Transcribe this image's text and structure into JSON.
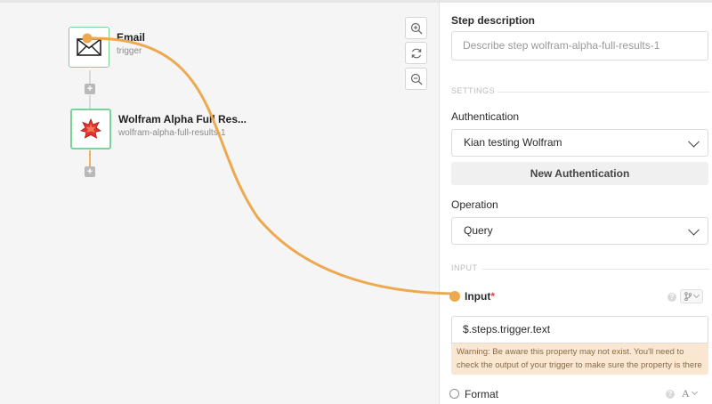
{
  "canvas": {
    "nodes": [
      {
        "title": "Email",
        "subtitle": "trigger",
        "icon": "envelope-icon"
      },
      {
        "title": "Wolfram Alpha Full Res...",
        "subtitle": "wolfram-alpha-full-results-1",
        "icon": "wolfram-logo-icon"
      }
    ],
    "add_step_symbol": "+",
    "controls": [
      "zoom-in-icon",
      "refresh-icon",
      "zoom-out-icon"
    ],
    "wire_color": "#eda94f"
  },
  "panel": {
    "step_description_label": "Step description",
    "step_description_placeholder": "Describe step wolfram-alpha-full-results-1",
    "settings_section": "SETTINGS",
    "authentication_label": "Authentication",
    "authentication_value": "Kian testing Wolfram",
    "new_auth_button": "New Authentication",
    "operation_label": "Operation",
    "operation_value": "Query",
    "input_section": "INPUT",
    "input_label": "Input",
    "required_mark": "*",
    "input_value": "$.steps.trigger.text",
    "help_symbol": "?",
    "warning_text": "Warning: Be aware this property may not exist. You'll need to check the output of your trigger to make sure the property is there",
    "format_label": "Format",
    "format_type_symbol": "A",
    "accent_color": "#eda94f"
  }
}
